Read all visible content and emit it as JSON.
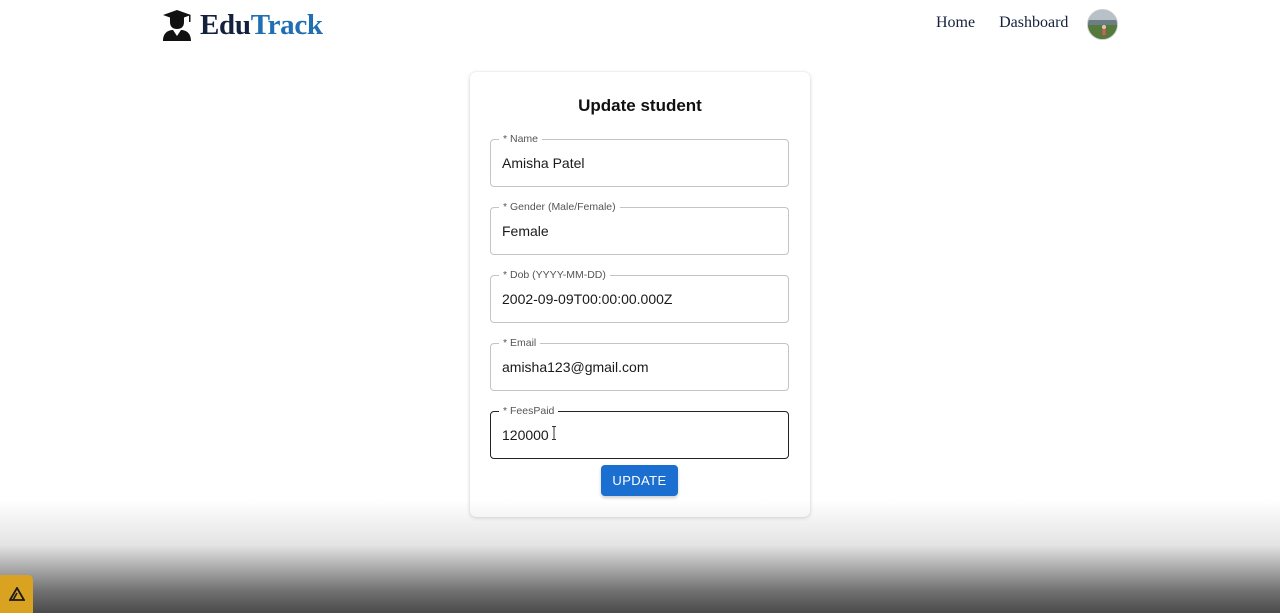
{
  "brand": {
    "name_part1": "Edu",
    "name_part2": "Track"
  },
  "nav": {
    "home": "Home",
    "dashboard": "Dashboard"
  },
  "form": {
    "title": "Update student",
    "fields": [
      {
        "label": "* Name",
        "value": "Amisha Patel"
      },
      {
        "label": "* Gender (Male/Female)",
        "value": "Female"
      },
      {
        "label": "* Dob (YYYY-MM-DD)",
        "value": "2002-09-09T00:00:00.000Z"
      },
      {
        "label": "* Email",
        "value": "amisha123@gmail.com"
      },
      {
        "label": "* FeesPaid",
        "value": "120000"
      }
    ],
    "submit_label": "UPDATE"
  },
  "colors": {
    "brand_dark": "#14213d",
    "brand_blue": "#1f6fb2",
    "button": "#1a6fd1",
    "corner_badge": "#d9a321"
  },
  "icons": [
    "graduate-icon",
    "avatar",
    "text-cursor-icon",
    "triangle-logo-icon"
  ]
}
